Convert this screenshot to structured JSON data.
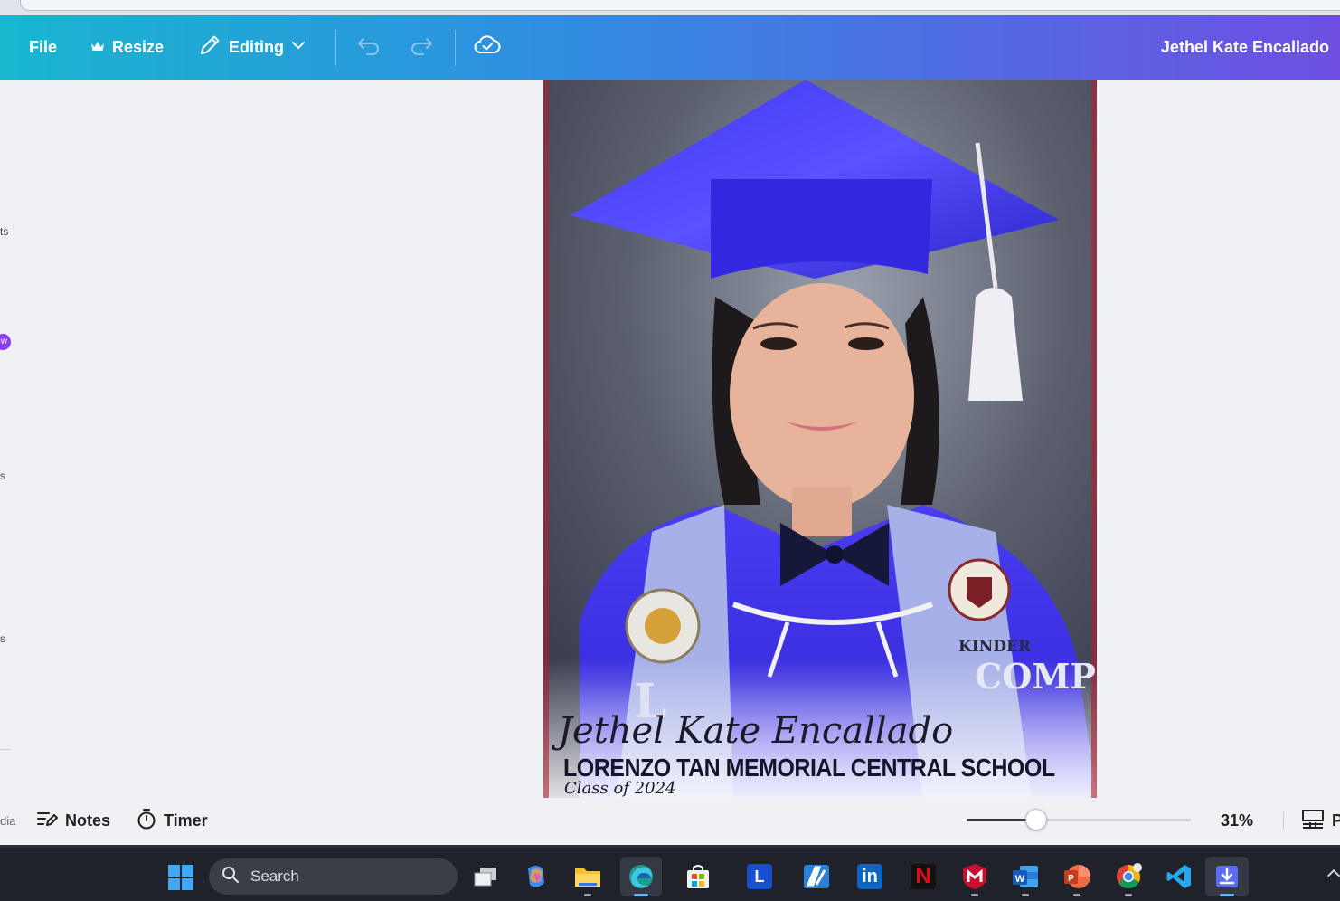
{
  "topbar": {
    "file_label": "File",
    "resize_label": "Resize",
    "editing_label": "Editing",
    "user_name": "Jethel Kate Encallado"
  },
  "left_panel": {
    "fragments": [
      "ts",
      "s",
      "s"
    ],
    "badge": "w",
    "bottom_fragment": "dia"
  },
  "design": {
    "name_script": "Jethel Kate Encallado",
    "school_name": "LORENZO TAN MEMORIAL CENTRAL SCHOOL",
    "class_of": "Class of 2024",
    "sash_right_label": "KINDER",
    "sash_vertical_text": "COMP"
  },
  "bottombar": {
    "notes_label": "Notes",
    "timer_label": "Timer",
    "zoom_value": "31%",
    "zoom_fraction": 0.31,
    "pages_fragment": "P"
  },
  "taskbar": {
    "search_label": "Search",
    "apps": [
      "task-view",
      "copilot",
      "file-explorer",
      "edge",
      "microsoft-store",
      "l-app",
      "pen-app",
      "linkedin",
      "netflix",
      "mcafee",
      "word",
      "powerpoint",
      "chrome",
      "vscode",
      "canva"
    ]
  },
  "colors": {
    "topbar_start": "#19b6cf",
    "topbar_end": "#6e4fe0",
    "accent_purple": "#8b3dff",
    "gown_blue": "#3b2fe0"
  }
}
